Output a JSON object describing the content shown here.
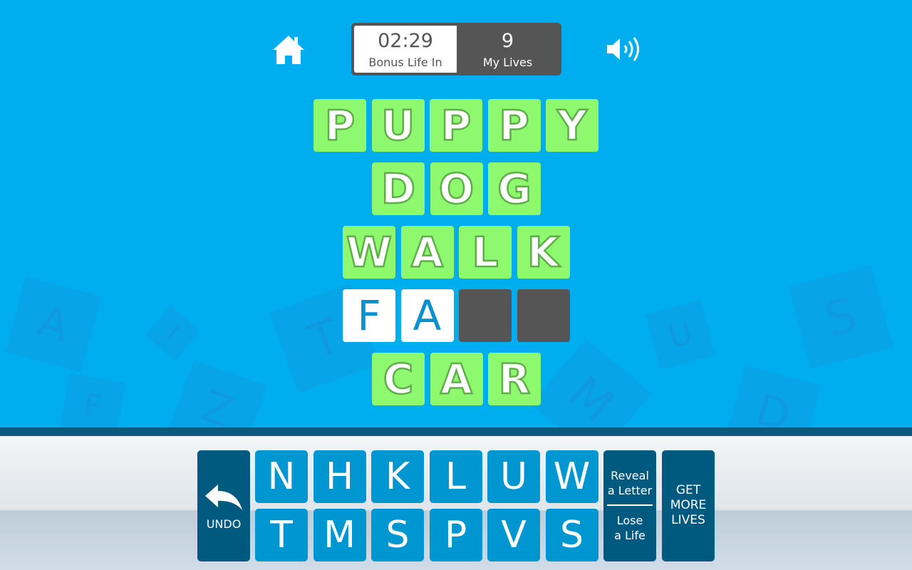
{
  "header": {
    "home_icon": "home-icon",
    "sound_icon": "speaker-icon",
    "timer": "02:29",
    "timer_label": "Bonus Life In",
    "lives": "9",
    "lives_label": "My Lives"
  },
  "colors": {
    "background": "#00adef",
    "solved_tile": "#8ef96f",
    "key": "#0096d1",
    "dark_button": "#005a80",
    "empty_tile": "#555555"
  },
  "puzzle": {
    "rows": [
      {
        "tiles": [
          {
            "l": "P",
            "s": "solved"
          },
          {
            "l": "U",
            "s": "solved"
          },
          {
            "l": "P",
            "s": "solved"
          },
          {
            "l": "P",
            "s": "solved"
          },
          {
            "l": "Y",
            "s": "solved"
          }
        ]
      },
      {
        "tiles": [
          {
            "l": "D",
            "s": "solved"
          },
          {
            "l": "O",
            "s": "solved"
          },
          {
            "l": "G",
            "s": "solved"
          }
        ]
      },
      {
        "tiles": [
          {
            "l": "W",
            "s": "solved"
          },
          {
            "l": "A",
            "s": "solved"
          },
          {
            "l": "L",
            "s": "solved"
          },
          {
            "l": "K",
            "s": "solved"
          }
        ]
      },
      {
        "tiles": [
          {
            "l": "F",
            "s": "filled"
          },
          {
            "l": "A",
            "s": "filled"
          },
          {
            "l": "",
            "s": "empty"
          },
          {
            "l": "",
            "s": "empty"
          }
        ]
      },
      {
        "tiles": [
          {
            "l": "C",
            "s": "solved"
          },
          {
            "l": "A",
            "s": "solved"
          },
          {
            "l": "R",
            "s": "solved"
          }
        ]
      }
    ]
  },
  "decor_letters": [
    "A",
    "I",
    "T",
    "Z",
    "F",
    "U",
    "S",
    "D",
    "M"
  ],
  "keyboard": {
    "undo": "UNDO",
    "keys_row1": [
      "N",
      "H",
      "K",
      "L",
      "U",
      "W"
    ],
    "keys_row2": [
      "T",
      "M",
      "S",
      "P",
      "V",
      "S"
    ],
    "reveal_1": "Reveal",
    "reveal_2": "a Letter",
    "lose_1": "Lose",
    "lose_2": "a Life",
    "more_1": "GET",
    "more_2": "MORE",
    "more_3": "LIVES"
  }
}
